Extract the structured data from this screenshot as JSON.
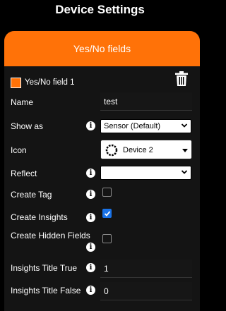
{
  "page": {
    "title": "Device Settings"
  },
  "panel": {
    "header_label": "Yes/No fields",
    "section_label": "Yes/No field 1",
    "accent_color": "#ff7208"
  },
  "form": {
    "name": {
      "label": "Name",
      "value": "test"
    },
    "show_as": {
      "label": "Show as",
      "selected": "Sensor (Default)"
    },
    "icon": {
      "label": "Icon",
      "selected": "Device 2"
    },
    "reflect": {
      "label": "Reflect",
      "selected": ""
    },
    "create_tag": {
      "label": "Create Tag",
      "checked": false
    },
    "create_insights": {
      "label": "Create Insights",
      "checked": true
    },
    "create_hidden_fields": {
      "label": "Create Hidden Fields",
      "checked": false
    },
    "insights_title_true": {
      "label": "Insights Title True",
      "value": "1"
    },
    "insights_title_false": {
      "label": "Insights Title False",
      "value": "0"
    }
  },
  "icons": {
    "info": "info-icon",
    "trash": "trash-icon",
    "device": "device-ring-icon",
    "dropdown": "chevron-down-icon"
  }
}
